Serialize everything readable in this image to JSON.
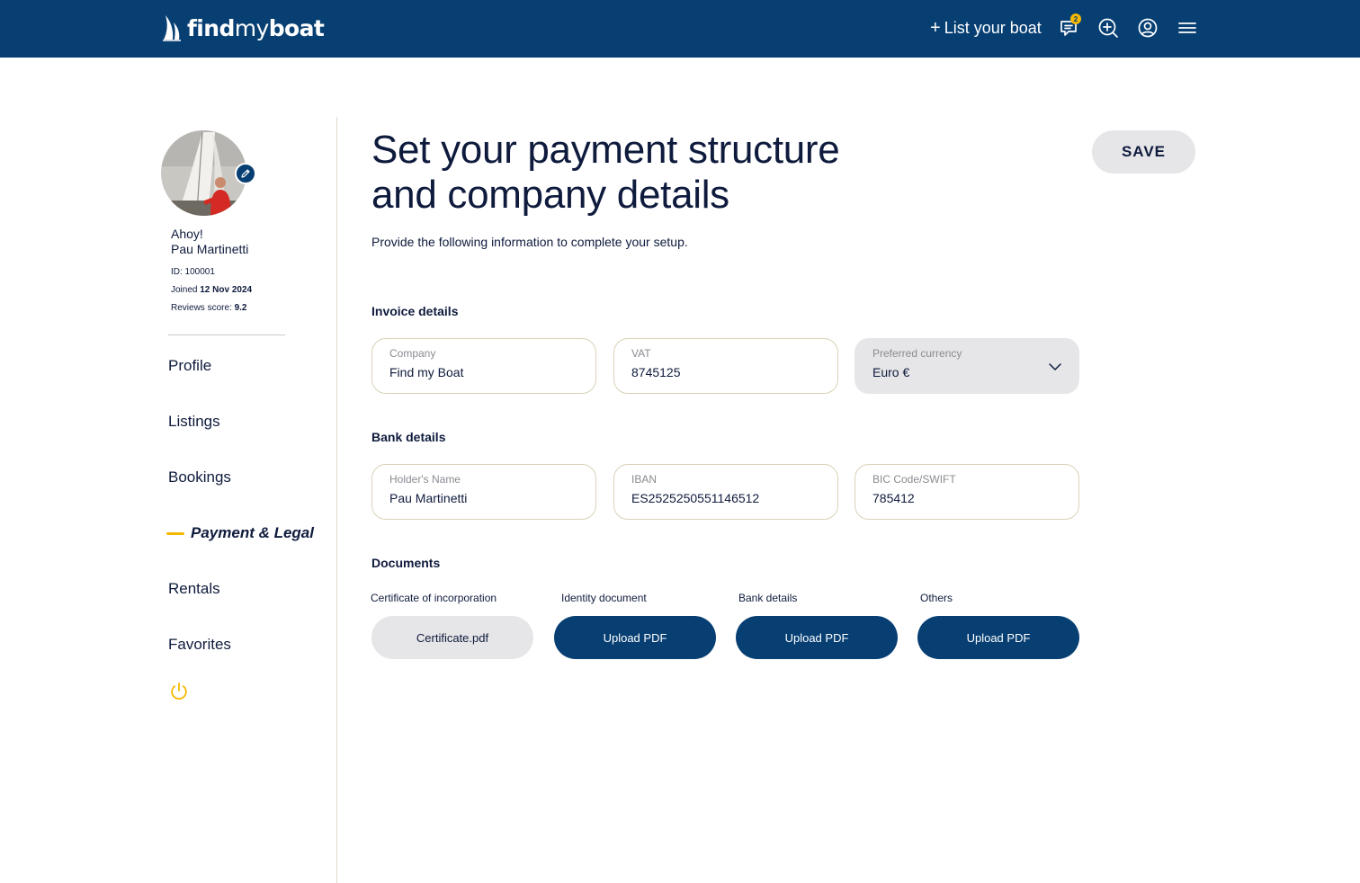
{
  "brand": {
    "logo_text_bold_a": "find",
    "logo_text_light": "my",
    "logo_text_bold_b": "boat",
    "primary_color": "#073f73",
    "accent_color": "#f5b800"
  },
  "header": {
    "list_boat_plus": "+",
    "list_boat_label": "List your boat",
    "messages_badge": "2",
    "icons": [
      "message-icon",
      "search-plus-icon",
      "user-circle-icon",
      "menu-icon"
    ]
  },
  "sidebar": {
    "greeting": "Ahoy!",
    "user_name": "Pau Martinetti",
    "id_text": "ID: 100001",
    "joined_label": "Joined",
    "joined_date": "12 Nov 2024",
    "reviews_label": "Reviews score:",
    "reviews_score": "9.2",
    "nav": [
      {
        "label": "Profile"
      },
      {
        "label": "Listings"
      },
      {
        "label": "Bookings"
      },
      {
        "label": "Payment & Legal",
        "active": true
      },
      {
        "label": "Rentals"
      },
      {
        "label": "Favorites"
      }
    ]
  },
  "main": {
    "title_line1": "Set your payment structure",
    "title_line2": "and company details",
    "subtitle": "Provide the following information to complete your setup.",
    "save_label": "SAVE",
    "invoice": {
      "title": "Invoice details",
      "company_label": "Company",
      "company_value": "Find my Boat",
      "vat_label": "VAT",
      "vat_value": "8745125",
      "currency_label": "Preferred currency",
      "currency_value": "Euro €"
    },
    "bank": {
      "title": "Bank details",
      "holder_label": "Holder's Name",
      "holder_value": "Pau Martinetti",
      "iban_label": "IBAN",
      "iban_value": "ES2525250551146512",
      "bic_label": "BIC Code/SWIFT",
      "bic_value": "785412"
    },
    "documents": {
      "title": "Documents",
      "items": [
        {
          "label": "Certificate of incorporation",
          "button": "Certificate.pdf",
          "uploaded": true
        },
        {
          "label": "Identity document",
          "button": "Upload PDF",
          "uploaded": false
        },
        {
          "label": "Bank details",
          "button": "Upload PDF",
          "uploaded": false
        },
        {
          "label": "Others",
          "button": "Upload PDF",
          "uploaded": false
        }
      ]
    }
  }
}
